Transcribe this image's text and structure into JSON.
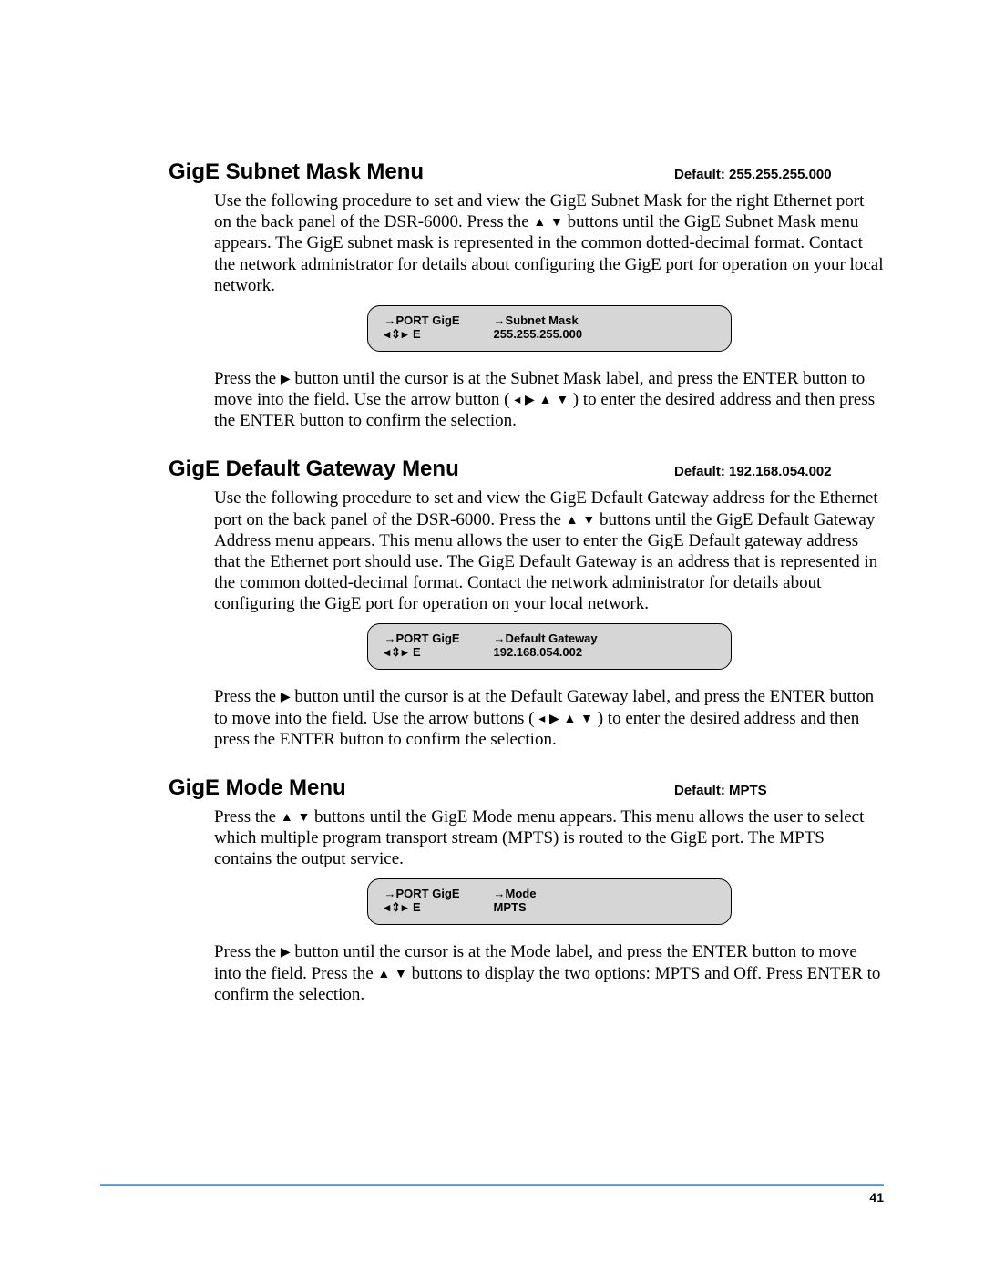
{
  "sections": [
    {
      "heading": "GigE Subnet Mask Menu",
      "default_label": "Default: 255.255.255.000",
      "para1_pre": "Use the following procedure to set and view the GigE Subnet Mask for the right Ethernet port on the back panel of the DSR-6000. Press the ",
      "para1_post": " buttons until the GigE Subnet Mask menu appears. The GigE subnet mask is represented in the common dotted-decimal format. Contact the network administrator for details about configuring the GigE port for operation on your local network.",
      "lcd": {
        "top_left": "→PORT GigE",
        "top_right": "→Subnet Mask",
        "bot_left_nav": "◂⇕▸ E",
        "bot_right": "255.255.255.000"
      },
      "para2_a": "Press the ",
      "para2_b": " button until the cursor is at the Subnet Mask label, and press the ENTER button to move into the field.  Use the arrow button ( ",
      "para2_c": " ) to enter the desired address and then press the ENTER button to confirm the selection."
    },
    {
      "heading": "GigE Default Gateway Menu",
      "default_label": "Default: 192.168.054.002",
      "para1_pre": "Use the following procedure to set and view the GigE Default Gateway address for the Ethernet port on the back panel of the DSR-6000. Press the ",
      "para1_post": " buttons until the GigE Default Gateway Address menu appears. This menu allows the user to enter the GigE Default gateway address that the Ethernet port should use. The GigE Default Gateway is an address that is represented in the common dotted-decimal format. Contact the network administrator for details about configuring the GigE port for operation on your local network.",
      "lcd": {
        "top_left": "→PORT GigE",
        "top_right": "→Default Gateway",
        "bot_left_nav": "◂⇕▸ E",
        "bot_right": "192.168.054.002"
      },
      "para2_a": "Press the ",
      "para2_b": " button until the cursor is at the Default Gateway label, and press the ENTER button to move into the field.  Use the arrow buttons ( ",
      "para2_c": " ) to enter the desired address and then press the ENTER button to confirm the selection."
    },
    {
      "heading": "GigE Mode Menu",
      "default_label": "Default: MPTS",
      "para1_pre": "Press the ",
      "para1_post": " buttons until the GigE Mode menu appears. This menu allows the user to select which multiple program transport stream (MPTS) is routed to the GigE port. The MPTS contains the output service.",
      "lcd": {
        "top_left": "→PORT GigE",
        "top_right": "→Mode",
        "bot_left_nav": "◂⇕▸ E",
        "bot_right": "MPTS"
      },
      "para2_a": "Press the  ",
      "para2_b": " button until the cursor is at the Mode label, and press the ENTER button to move into the field. Press the ",
      "para2_c": " buttons to display the two options: MPTS and Off. Press ENTER to confirm the selection."
    }
  ],
  "icons": {
    "up": "▲",
    "down": "▼",
    "left": "◂",
    "right": "▸",
    "right_solid": "▶"
  },
  "page_number": "41"
}
